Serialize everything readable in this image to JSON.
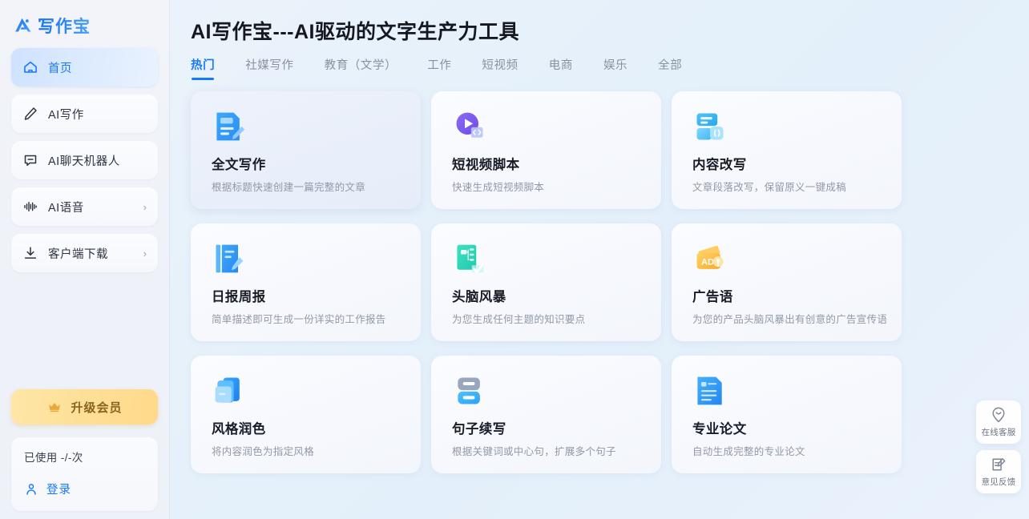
{
  "app": {
    "logo_text": "写作宝",
    "logo_icon": "brand-logo-icon"
  },
  "sidebar": {
    "items": [
      {
        "label": "首页",
        "icon": "home-icon",
        "active": true,
        "chevron": ""
      },
      {
        "label": "AI写作",
        "icon": "pencil-icon",
        "active": false,
        "chevron": ""
      },
      {
        "label": "AI聊天机器人",
        "icon": "chat-minus-icon",
        "active": false,
        "chevron": ""
      },
      {
        "label": "AI语音",
        "icon": "waveform-icon",
        "active": false,
        "chevron": "›"
      },
      {
        "label": "客户端下载",
        "icon": "download-icon",
        "active": false,
        "chevron": "›"
      }
    ],
    "upgrade": {
      "label": "升级会员",
      "icon": "crown-icon"
    },
    "usage": {
      "text": "已使用 -/-次"
    },
    "login": {
      "label": "登录",
      "icon": "user-icon"
    }
  },
  "header": {
    "title": "AI写作宝---AI驱动的文字生产力工具"
  },
  "tabs": [
    {
      "label": "热门",
      "active": true
    },
    {
      "label": "社媒写作",
      "active": false
    },
    {
      "label": "教育（文学）",
      "active": false
    },
    {
      "label": "工作",
      "active": false
    },
    {
      "label": "短视频",
      "active": false
    },
    {
      "label": "电商",
      "active": false
    },
    {
      "label": "娱乐",
      "active": false
    },
    {
      "label": "全部",
      "active": false
    }
  ],
  "cards": [
    {
      "title": "全文写作",
      "desc": "根据标题快速创建一篇完整的文章",
      "icon": "document-pencil-icon",
      "hovered": true
    },
    {
      "title": "短视频脚本",
      "desc": "快速生成短视频脚本",
      "icon": "play-circle-icon",
      "hovered": false
    },
    {
      "title": "内容改写",
      "desc": "文章段落改写，保留原义一键成稿",
      "icon": "rewrite-blocks-icon",
      "hovered": false
    },
    {
      "title": "日报周报",
      "desc": "简单描述即可生成一份详实的工作报告",
      "icon": "notebook-pencil-icon",
      "hovered": false
    },
    {
      "title": "头脑风暴",
      "desc": "为您生成任何主题的知识要点",
      "icon": "mindmap-check-icon",
      "hovered": false
    },
    {
      "title": "广告语",
      "desc": "为您的产品头脑风暴出有创意的广告宣传语",
      "icon": "ad-tag-icon",
      "hovered": false
    },
    {
      "title": "风格润色",
      "desc": "将内容润色为指定风格",
      "icon": "layers-icon",
      "hovered": false
    },
    {
      "title": "句子续写",
      "desc": "根据关键词或中心句，扩展多个句子",
      "icon": "two-bars-icon",
      "hovered": false
    },
    {
      "title": "专业论文",
      "desc": "自动生成完整的专业论文",
      "icon": "paper-doc-icon",
      "hovered": false
    }
  ],
  "float_dock": [
    {
      "label": "在线客服",
      "icon": "smile-chat-icon"
    },
    {
      "label": "意见反馈",
      "icon": "feedback-edit-icon"
    }
  ],
  "colors": {
    "brand_blue": "#1677ff",
    "active_nav_bg": "#d7e7fe",
    "upgrade_gold": "#ffd98a",
    "title_dark": "#15181f",
    "muted_text": "#9298a6"
  }
}
